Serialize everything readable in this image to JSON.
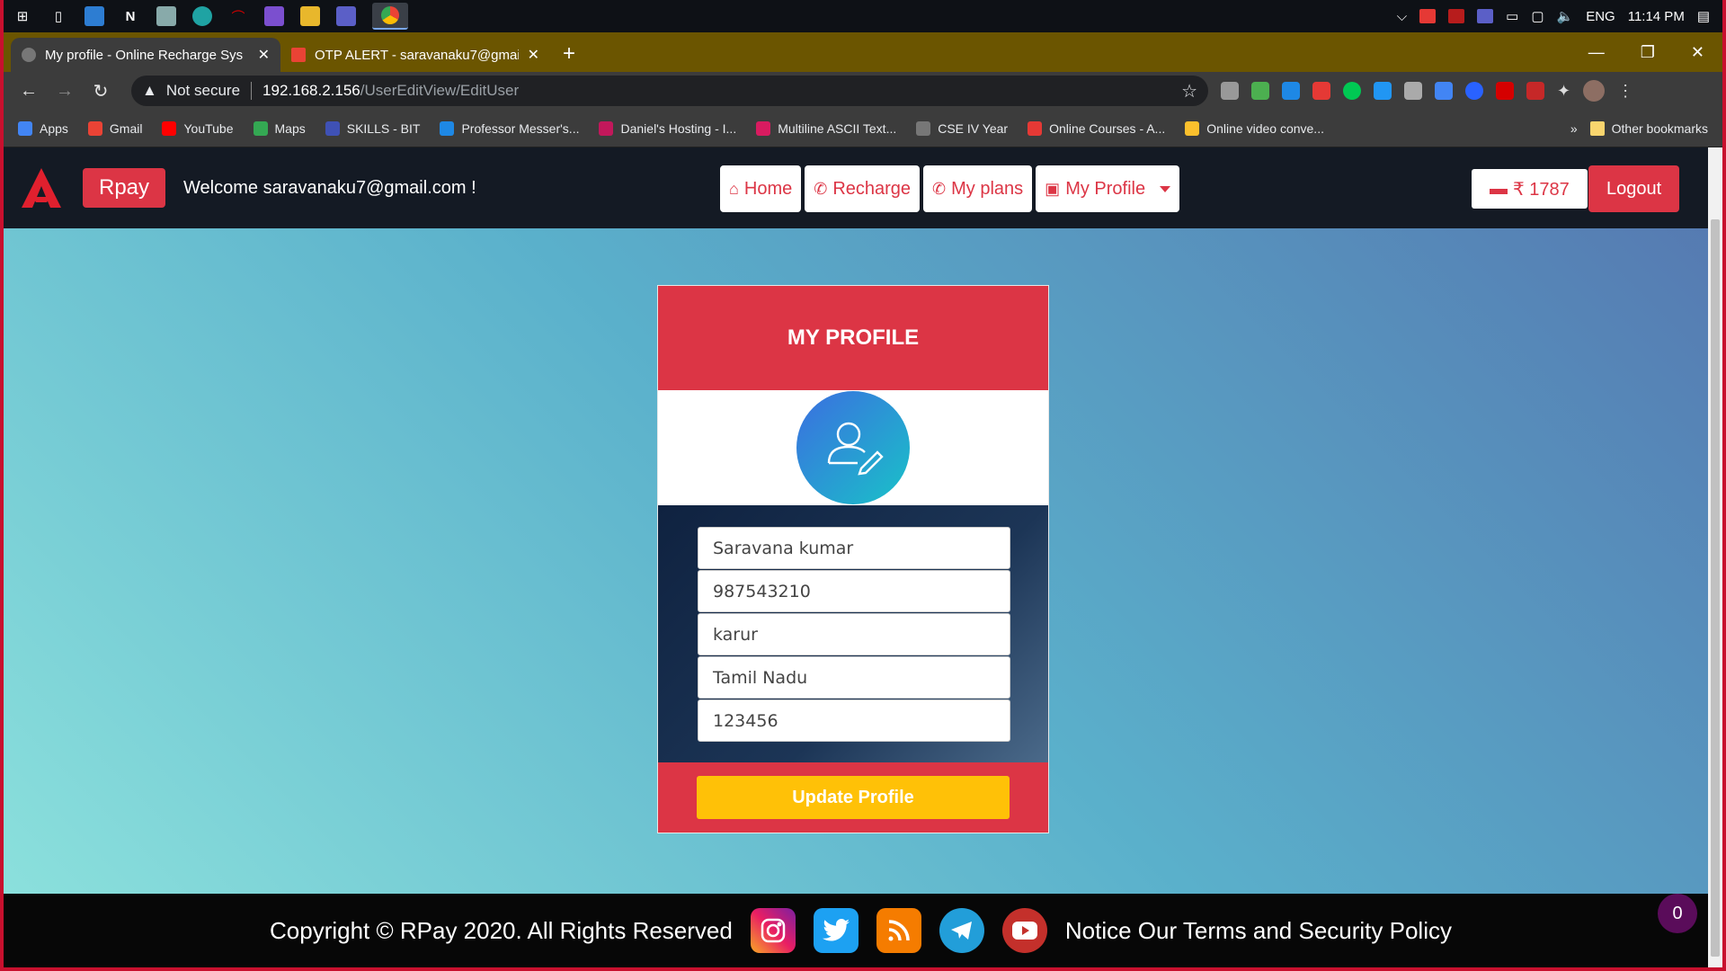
{
  "taskbar": {
    "tray": {
      "language": "ENG",
      "time": "11:14 PM"
    }
  },
  "tabs": [
    {
      "title": "My profile - Online Recharge Sys",
      "active": true
    },
    {
      "title": "OTP ALERT - saravanaku7@gmail",
      "active": false
    }
  ],
  "address_bar": {
    "security_label": "Not secure",
    "host": "192.168.2.156",
    "path": "/UserEditView/EditUser"
  },
  "bookmarks": [
    {
      "label": "Apps",
      "color": "#4285f4"
    },
    {
      "label": "Gmail",
      "color": "#ea4335"
    },
    {
      "label": "YouTube",
      "color": "#ff0000"
    },
    {
      "label": "Maps",
      "color": "#34a853"
    },
    {
      "label": "SKILLS - BIT",
      "color": "#3f51b5"
    },
    {
      "label": "Professor Messer's...",
      "color": "#1e88e5"
    },
    {
      "label": "Daniel's Hosting - I...",
      "color": "#c2185b"
    },
    {
      "label": "Multiline ASCII Text...",
      "color": "#d81b60"
    },
    {
      "label": "CSE IV Year",
      "color": "#777777"
    },
    {
      "label": "Online Courses - A...",
      "color": "#e53935"
    },
    {
      "label": "Online video conve...",
      "color": "#fbc02d"
    }
  ],
  "bookmarks_more": "»",
  "other_bookmarks": "Other bookmarks",
  "site": {
    "brand": "Rpay",
    "welcome": "Welcome saravanaku7@gmail.com !",
    "nav": {
      "home": "Home",
      "recharge": "Recharge",
      "plans": "My plans",
      "profile": "My Profile"
    },
    "balance": "₹ 1787",
    "logout": "Logout",
    "colors": {
      "primary": "#dc3545",
      "accent": "#ffc107"
    }
  },
  "profile": {
    "title": "MY PROFILE",
    "fields": {
      "name": "Saravana kumar",
      "phone": "987543210",
      "city": "karur",
      "state": "Tamil Nadu",
      "pin": "123456"
    },
    "update_button": "Update Profile"
  },
  "footer": {
    "copyright": "Copyright © RPay 2020. All Rights Reserved",
    "socials": [
      "instagram",
      "twitter",
      "rss",
      "telegram",
      "youtube"
    ],
    "notice": "Notice Our Terms and Security Policy",
    "badge": "0"
  }
}
